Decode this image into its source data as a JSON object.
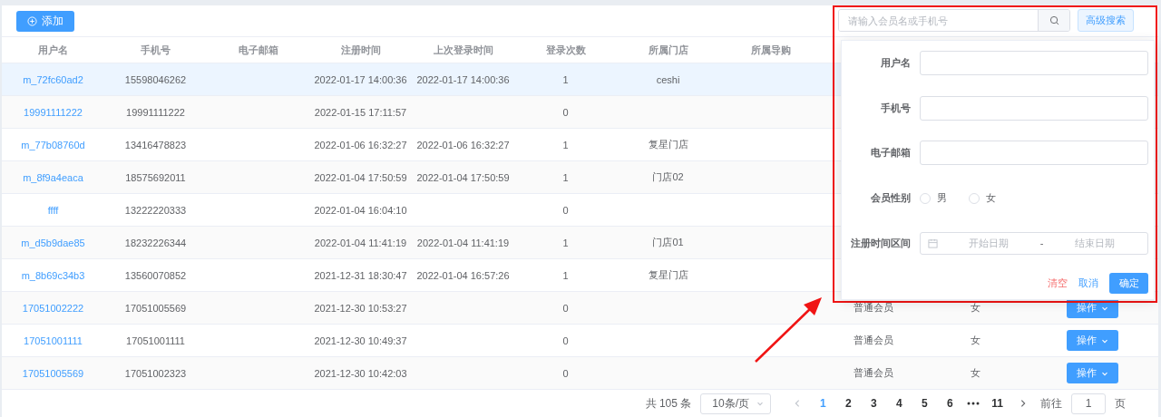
{
  "toolbar": {
    "add_button": "添加"
  },
  "search": {
    "placeholder": "请输入会员名或手机号",
    "advanced_button": "高级搜索"
  },
  "table": {
    "columns": [
      "用户名",
      "手机号",
      "电子邮箱",
      "注册时间",
      "上次登录时间",
      "登录次数",
      "所属门店",
      "所属导购"
    ],
    "rows": [
      {
        "selected": true,
        "username": "m_72fc60ad2",
        "phone": "15598046262",
        "registered": "2022-01-17 14:00:36",
        "last_login": "2022-01-17 14:00:36",
        "login_count": "1",
        "store": "ceshi"
      },
      {
        "selected": false,
        "username": "19991111222",
        "phone": "19991111222",
        "registered": "2022-01-15 17:11:57",
        "login_count": "0"
      },
      {
        "selected": false,
        "username": "m_77b08760d",
        "phone": "13416478823",
        "registered": "2022-01-06 16:32:27",
        "last_login": "2022-01-06 16:32:27",
        "login_count": "1",
        "store": "复星门店"
      },
      {
        "selected": false,
        "username": "m_8f9a4eaca",
        "phone": "18575692011",
        "registered": "2022-01-04 17:50:59",
        "last_login": "2022-01-04 17:50:59",
        "login_count": "1",
        "store": "门店02"
      },
      {
        "selected": false,
        "username": "ffff",
        "phone": "13222220333",
        "registered": "2022-01-04 16:04:10",
        "login_count": "0"
      },
      {
        "selected": false,
        "username": "m_d5b9dae85",
        "phone": "18232226344",
        "registered": "2022-01-04 11:41:19",
        "last_login": "2022-01-04 11:41:19",
        "login_count": "1",
        "store": "门店01"
      },
      {
        "selected": false,
        "username": "m_8b69c34b3",
        "phone": "13560070852",
        "registered": "2021-12-31 18:30:47",
        "last_login": "2022-01-04 16:57:26",
        "login_count": "1",
        "store": "复星门店"
      },
      {
        "selected": false,
        "username": "17051002222",
        "phone": "17051005569",
        "registered": "2021-12-30 10:53:27",
        "login_count": "0",
        "level": "普通会员",
        "gender": "女",
        "action": "操作"
      },
      {
        "selected": false,
        "username": "17051001111",
        "phone": "17051001111",
        "registered": "2021-12-30 10:49:37",
        "login_count": "0",
        "level": "普通会员",
        "gender": "女",
        "action": "操作"
      },
      {
        "selected": false,
        "username": "17051005569",
        "phone": "17051002323",
        "registered": "2021-12-30 10:42:03",
        "login_count": "0",
        "level": "普通会员",
        "gender": "女",
        "action": "操作"
      }
    ]
  },
  "advanced_search": {
    "fields": [
      {
        "kind": "text",
        "label": "用户名"
      },
      {
        "kind": "text",
        "label": "手机号"
      },
      {
        "kind": "text",
        "label": "电子邮箱"
      },
      {
        "kind": "radio",
        "label": "会员性别",
        "options": [
          {
            "label": "男",
            "selected": false
          },
          {
            "label": "女",
            "selected": false
          }
        ]
      },
      {
        "kind": "daterange",
        "label": "注册时间区间",
        "start_placeholder": "开始日期",
        "separator": "-",
        "end_placeholder": "结束日期"
      }
    ],
    "clear": "清空",
    "cancel": "取消",
    "confirm": "确定"
  },
  "pagination": {
    "total": "共 105 条",
    "page_size": "10条/页",
    "pages": [
      {
        "kind": "page",
        "label": "1",
        "selected": true
      },
      {
        "kind": "page",
        "label": "2",
        "selected": false
      },
      {
        "kind": "page",
        "label": "3",
        "selected": false
      },
      {
        "kind": "page",
        "label": "4",
        "selected": false
      },
      {
        "kind": "page",
        "label": "5",
        "selected": false
      },
      {
        "kind": "page",
        "label": "6",
        "selected": false
      },
      {
        "kind": "more",
        "selected": false
      },
      {
        "kind": "page",
        "label": "11",
        "selected": false
      }
    ],
    "goto_label": "前往",
    "goto_value": "1",
    "page_suffix": "页"
  }
}
